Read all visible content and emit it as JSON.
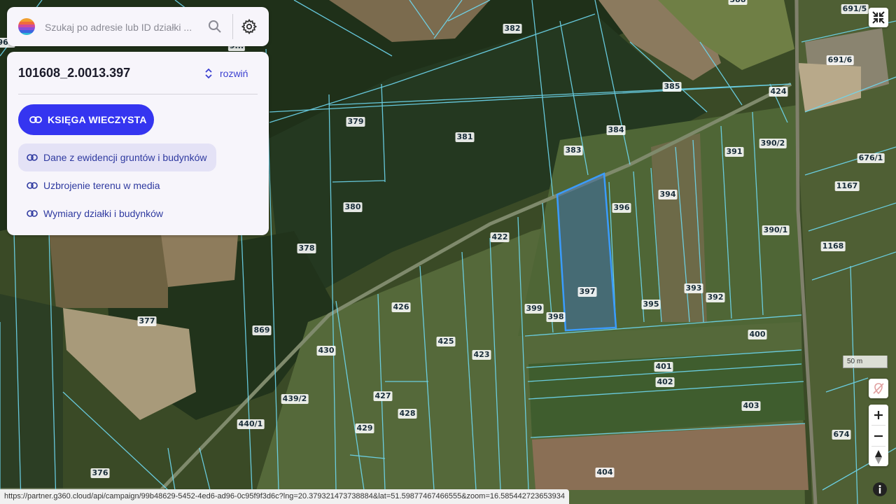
{
  "search": {
    "placeholder": "Szukaj po adresie lub ID działki ..."
  },
  "panel": {
    "parcel_id": "101608_2.0013.397",
    "expand_label": "rozwiń",
    "kw_button_label": "KSIĘGA WIECZYSTA",
    "links": [
      {
        "label": "Dane z ewidencji gruntów i budynków",
        "active": true
      },
      {
        "label": "Uzbrojenie terenu w media",
        "active": false
      },
      {
        "label": "Wymiary działki i budynków",
        "active": false
      }
    ]
  },
  "map": {
    "selected_parcel": "397",
    "parcel_labels": [
      "382",
      "385",
      "424",
      "384",
      "391",
      "390/2",
      "676/1",
      "1167",
      "379",
      "381",
      "383",
      "394",
      "396",
      "390/1",
      "1168",
      "380",
      "378",
      "422",
      "397",
      "393",
      "392",
      "395",
      "399",
      "398",
      "426",
      "425",
      "423",
      "377",
      "869",
      "430",
      "400",
      "401",
      "402",
      "403",
      "439/2",
      "427",
      "428",
      "429",
      "440/1",
      "404",
      "674",
      "376",
      "691/5",
      "691/6",
      "388",
      "960",
      "9...",
      "140"
    ],
    "scale_label": "50 m"
  },
  "status_url": "https://partner.g360.cloud/api/campaign/99b48629-5452-4ed6-ad96-0c95f9f3d6c?lng=20.379321473738884&lat=51.59877467466555&zoom=16.585442723653934",
  "colors": {
    "accent": "#3535f0",
    "link": "#2f3aa0",
    "parcel_line": "#6ed8f0",
    "selected_fill": "#3f6fa8",
    "selected_stroke": "#3a9cff"
  },
  "icons": [
    "logo-icon",
    "search-icon",
    "gear-icon",
    "chevron-updown-icon",
    "link-icon",
    "collapse-icon",
    "layer-off-icon",
    "zoom-in-icon",
    "zoom-out-icon",
    "compass-icon",
    "info-icon"
  ]
}
